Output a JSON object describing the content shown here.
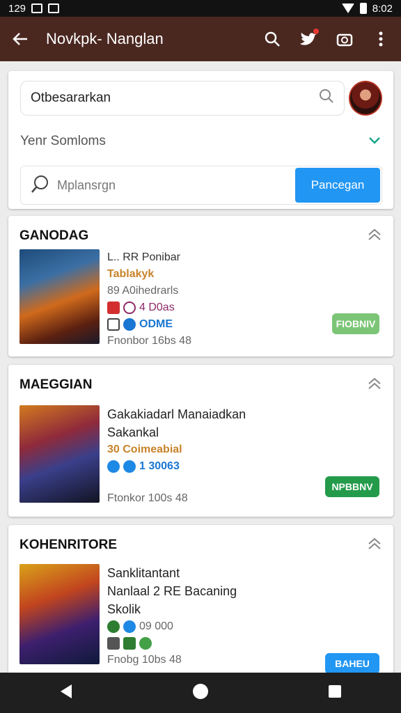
{
  "statusbar": {
    "time": "129",
    "clock": "8:02"
  },
  "appbar": {
    "title": "Novkpk- Nanglan"
  },
  "search": {
    "query": "Otbesararkan",
    "dropdown_label": "Yenr Somloms",
    "secondary_placeholder": "Mplansrgn",
    "button_label": "Pancegan"
  },
  "cards": [
    {
      "header": "GANODAG",
      "lines": [
        "L.. RR Ponibar",
        "Tablakyk",
        "89  A0ihedrarls",
        "4 D0as",
        "ODME",
        "Fnonbor 16bs 48"
      ],
      "tag": "FIOBNIV",
      "tag_color": "#7cc576"
    },
    {
      "header": "MAEGGIAN",
      "lines": [
        "Gakakiadarl Manaiadkan",
        "Sakankal",
        "30  Coimeabial",
        "1 30063",
        "Ftonkor 100s 48"
      ],
      "tag": "NPBBNV",
      "tag_color": "#239b4a"
    },
    {
      "header": "KOHENRITORE",
      "lines": [
        "Sanklitantant",
        "Nanlaal 2 RE Bacaning",
        "Skolik",
        "09 000",
        "Fnobg 10bs 48"
      ],
      "tag": "BAHEU",
      "tag_color": "#2196f3"
    }
  ],
  "icons": [
    "back-arrow-icon",
    "search-icon",
    "twitter-icon",
    "camera-icon",
    "more-vert-icon",
    "chevron-down-icon",
    "chevron-up-icon"
  ]
}
